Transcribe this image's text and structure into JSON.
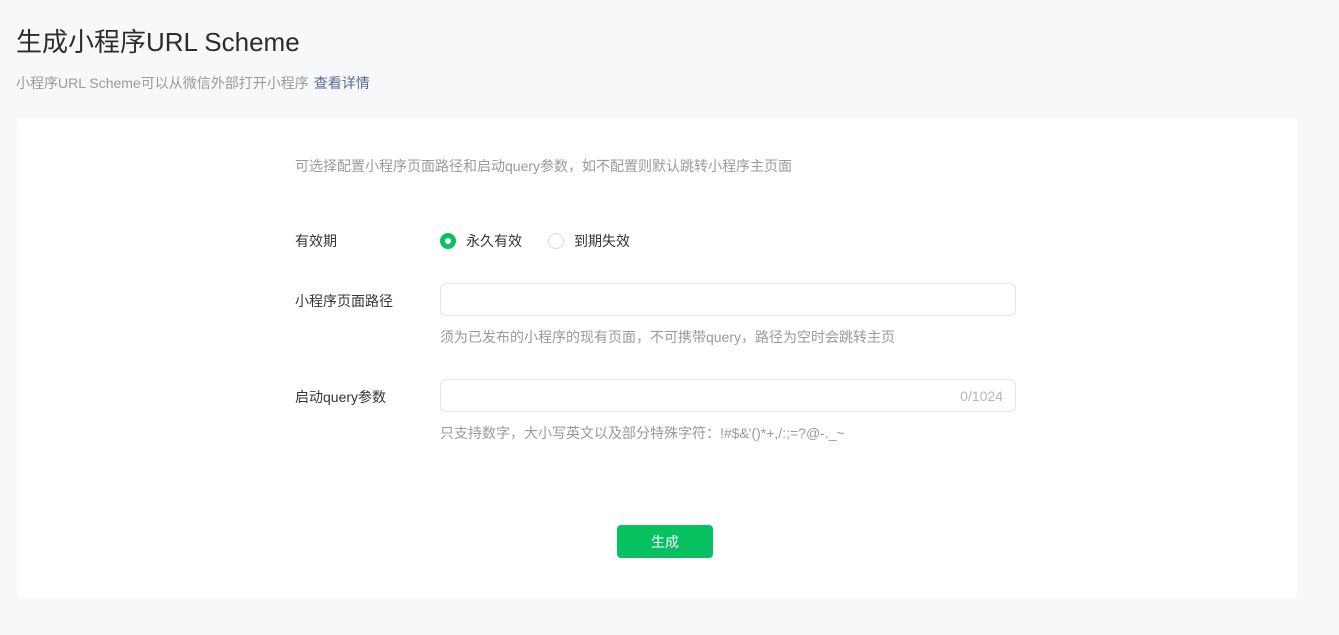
{
  "page": {
    "title": "生成小程序URL Scheme",
    "subtitle": "小程序URL Scheme可以从微信外部打开小程序",
    "details_link": "查看详情"
  },
  "form": {
    "description": "可选择配置小程序页面路径和启动query参数，如不配置则默认跳转小程序主页面",
    "validity": {
      "label": "有效期",
      "options": [
        {
          "label": "永久有效",
          "selected": true
        },
        {
          "label": "到期失效",
          "selected": false
        }
      ]
    },
    "path": {
      "label": "小程序页面路径",
      "value": "",
      "placeholder": "",
      "help": "须为已发布的小程序的现有页面，不可携带query，路径为空时会跳转主页"
    },
    "query": {
      "label": "启动query参数",
      "value": "",
      "placeholder": "",
      "counter": "0/1024",
      "help": "只支持数字，大小写英文以及部分特殊字符：!#$&'()*+,/:;=?@-._~"
    },
    "submit_label": "生成"
  },
  "colors": {
    "accent_green": "#07c160",
    "link_blue": "#576b95",
    "page_background": "#f7f8fa",
    "card_background": "#ffffff"
  }
}
